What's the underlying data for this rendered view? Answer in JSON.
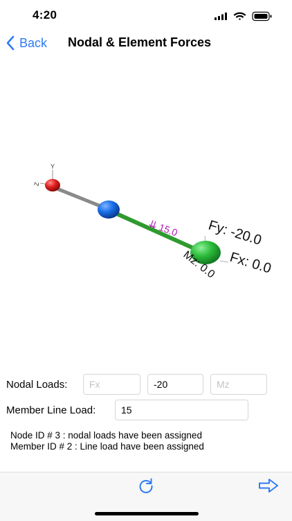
{
  "status_bar": {
    "time": "4:20"
  },
  "nav": {
    "back_label": "Back",
    "title": "Nodal & Element Forces"
  },
  "scene": {
    "axis_y": "Y",
    "axis_z": "Z",
    "line_load_label": "⇊ 15.0",
    "fy_label": "Fy: -20.0",
    "fx_label": "Fx: 0.0",
    "mz_label": "Mz: 0.0",
    "colors": {
      "node_start": "#e02020",
      "node_mid": "#1a6fe8",
      "node_end": "#2ebd3c",
      "member_1": "#8a8a8a",
      "member_2": "#2f9a2f",
      "annotation_load": "#b01ab0"
    }
  },
  "nodal_loads": {
    "label": "Nodal Loads:",
    "fx": {
      "value": "",
      "placeholder": "Fx"
    },
    "fy": {
      "value": "-20",
      "placeholder": ""
    },
    "mz": {
      "value": "",
      "placeholder": "Mz"
    }
  },
  "member_line_load": {
    "label": "Member Line Load:",
    "value": "15"
  },
  "messages": [
    "Node ID # 3 : nodal loads have been assigned",
    "Member ID # 2 : Line load have been assigned"
  ],
  "toolbar": {
    "left_icon": "refresh-icon",
    "right_icon": "arrow-right-icon"
  }
}
